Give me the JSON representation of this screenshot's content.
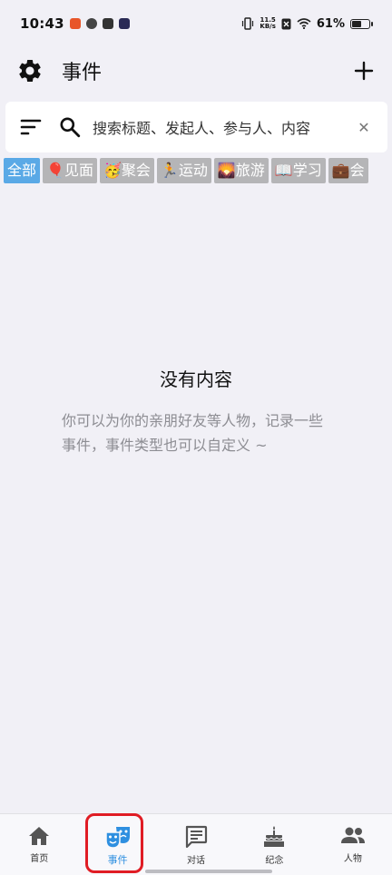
{
  "status_bar": {
    "time": "10:43",
    "net_speed_value": "11.5",
    "net_speed_unit": "KB/s",
    "battery": "61%",
    "battery_level": 0.61
  },
  "header": {
    "title": "事件",
    "settings_icon": "gear-icon",
    "add_icon": "plus-icon"
  },
  "search": {
    "placeholder": "搜索标题、发起人、参与人、内容",
    "sort_icon": "sort-icon",
    "search_icon": "search-icon",
    "clear_icon": "close-icon"
  },
  "categories": [
    {
      "label": "全部",
      "emoji": "",
      "active": true
    },
    {
      "label": "见面",
      "emoji": "🎈",
      "active": false
    },
    {
      "label": "聚会",
      "emoji": "🥳",
      "active": false
    },
    {
      "label": "运动",
      "emoji": "🏃",
      "active": false
    },
    {
      "label": "旅游",
      "emoji": "🌄",
      "active": false
    },
    {
      "label": "学习",
      "emoji": "📖",
      "active": false
    },
    {
      "label": "会",
      "emoji": "💼",
      "active": false
    }
  ],
  "empty": {
    "title": "没有内容",
    "description": "你可以为你的亲朋好友等人物，记录一些事件，事件类型也可以自定义 ~"
  },
  "bottom_nav": [
    {
      "label": "首页",
      "icon": "home-icon",
      "active": false
    },
    {
      "label": "事件",
      "icon": "masks-icon",
      "active": true
    },
    {
      "label": "对话",
      "icon": "chat-icon",
      "active": false
    },
    {
      "label": "纪念",
      "icon": "cake-icon",
      "active": false
    },
    {
      "label": "人物",
      "icon": "people-icon",
      "active": false
    }
  ],
  "colors": {
    "accent": "#2e8fe0",
    "chip_active": "#5aa9e6",
    "chip_inactive": "#b5b5b7",
    "highlight": "#e01c24"
  }
}
